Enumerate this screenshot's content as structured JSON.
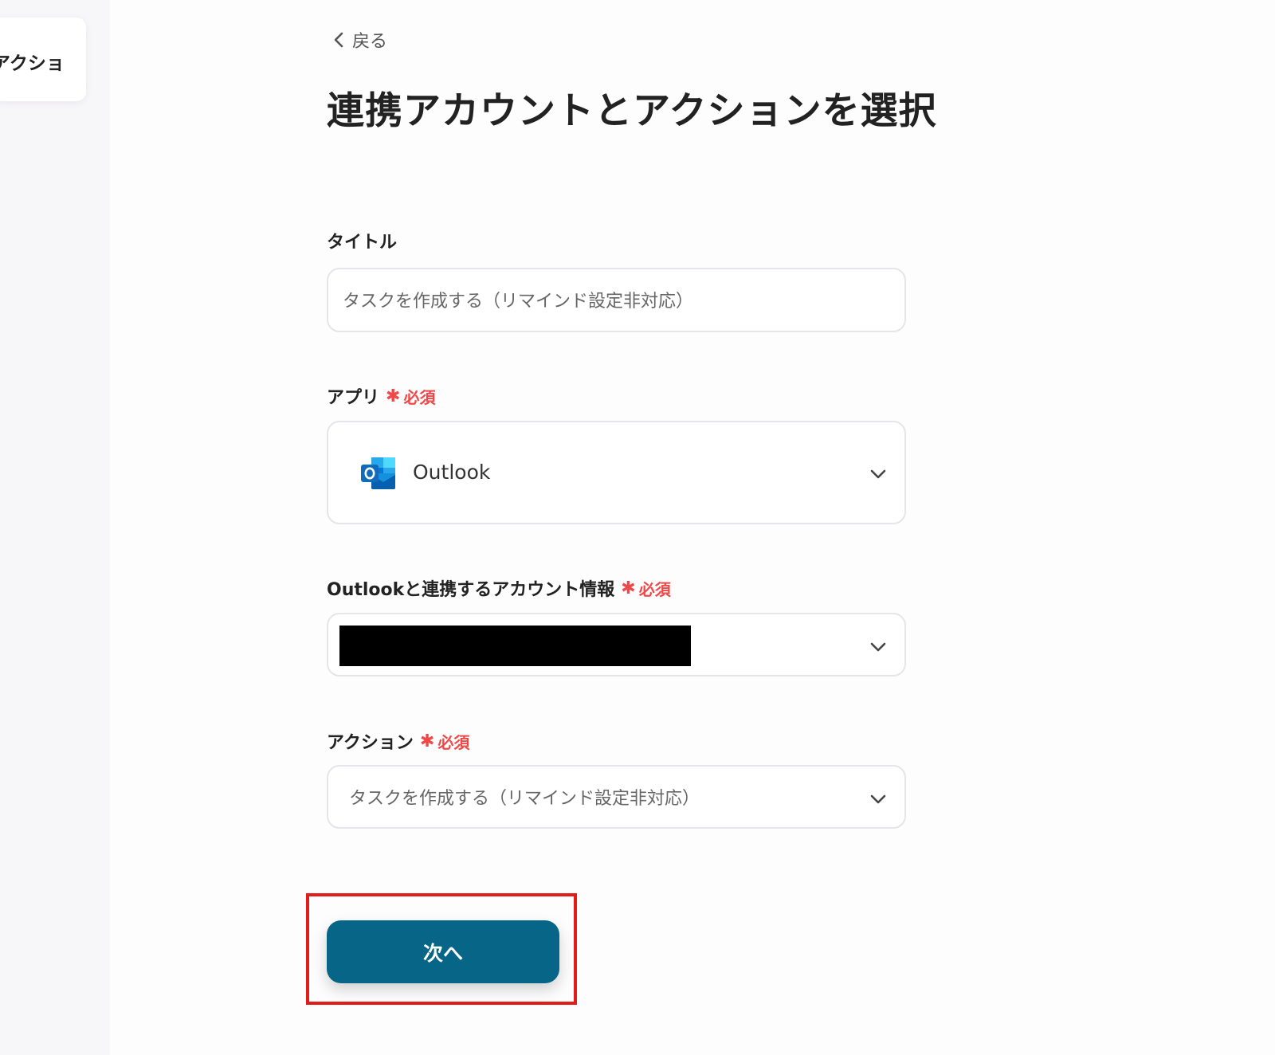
{
  "sidebar": {
    "card_label": "アクショ"
  },
  "header": {
    "back_label": "戻る",
    "title": "連携アカウントとアクションを選択"
  },
  "form": {
    "title_field": {
      "label": "タイトル",
      "value": "タスクを作成する（リマインド設定非対応）"
    },
    "app_field": {
      "label": "アプリ",
      "required_label": "必須",
      "selected_app": "Outlook",
      "icon": "outlook-icon"
    },
    "account_field": {
      "label": "Outlookと連携するアカウント情報",
      "required_label": "必須"
    },
    "action_field": {
      "label": "アクション",
      "required_label": "必須",
      "value": "タスクを作成する（リマインド設定非対応）"
    }
  },
  "footer": {
    "next_label": "次へ"
  },
  "colors": {
    "accent": "#076587",
    "required": "#f04848",
    "highlight": "#e21b1b"
  }
}
